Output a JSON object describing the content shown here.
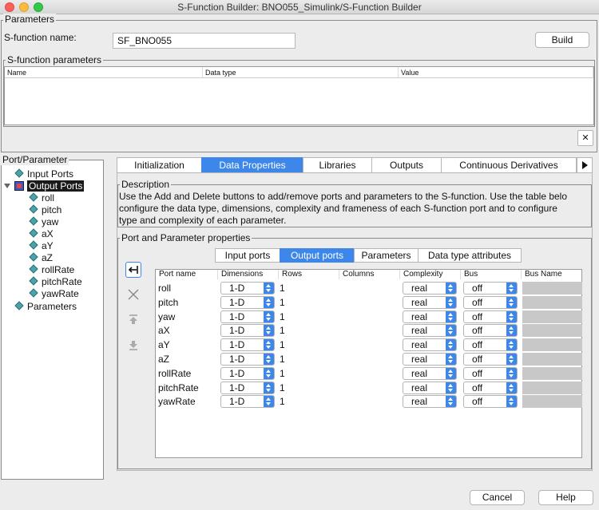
{
  "window": {
    "title": "S-Function Builder: BNO055_Simulink/S-Function Builder"
  },
  "parameters_group": {
    "title": "Parameters",
    "sfunction_name_label": "S-function name:",
    "sfunction_name_value": "SF_BNO055",
    "build_label": "Build"
  },
  "sfunction_params": {
    "title": "S-function parameters",
    "columns": [
      "Name",
      "Data type",
      "Value"
    ],
    "delete_label": "✕"
  },
  "tree": {
    "title": "Port/Parameter",
    "input_ports": "Input Ports",
    "output_ports": "Output Ports",
    "outputs": [
      "roll",
      "pitch",
      "yaw",
      "aX",
      "aY",
      "aZ",
      "rollRate",
      "pitchRate",
      "yawRate"
    ],
    "parameters": "Parameters"
  },
  "tabs": [
    "Initialization",
    "Data Properties",
    "Libraries",
    "Outputs",
    "Continuous Derivatives"
  ],
  "active_tab": "Data Properties",
  "description": {
    "title": "Description",
    "lines": [
      "Use the Add and Delete buttons to add/remove ports and parameters to the S-function. Use the table belo",
      "configure the data type, dimensions, complexity and frameness of each S-function port and to configure",
      "type and complexity of each parameter."
    ]
  },
  "port_props": {
    "title": "Port and Parameter properties",
    "subtabs": [
      "Input ports",
      "Output ports",
      "Parameters",
      "Data type attributes"
    ],
    "active_subtab": "Output ports",
    "columns": [
      "Port name",
      "Dimensions",
      "Rows",
      "Columns",
      "Complexity",
      "Bus",
      "Bus Name"
    ],
    "rows": [
      {
        "name": "roll",
        "dims": "1-D",
        "rows": "1",
        "complexity": "real",
        "bus": "off"
      },
      {
        "name": "pitch",
        "dims": "1-D",
        "rows": "1",
        "complexity": "real",
        "bus": "off"
      },
      {
        "name": "yaw",
        "dims": "1-D",
        "rows": "1",
        "complexity": "real",
        "bus": "off"
      },
      {
        "name": "aX",
        "dims": "1-D",
        "rows": "1",
        "complexity": "real",
        "bus": "off"
      },
      {
        "name": "aY",
        "dims": "1-D",
        "rows": "1",
        "complexity": "real",
        "bus": "off"
      },
      {
        "name": "aZ",
        "dims": "1-D",
        "rows": "1",
        "complexity": "real",
        "bus": "off"
      },
      {
        "name": "rollRate",
        "dims": "1-D",
        "rows": "1",
        "complexity": "real",
        "bus": "off"
      },
      {
        "name": "pitchRate",
        "dims": "1-D",
        "rows": "1",
        "complexity": "real",
        "bus": "off"
      },
      {
        "name": "yawRate",
        "dims": "1-D",
        "rows": "1",
        "complexity": "real",
        "bus": "off"
      }
    ]
  },
  "footer": {
    "cancel_label": "Cancel",
    "help_label": "Help"
  },
  "colors": {
    "accent": "#3d86ea",
    "window_bg": "#ececec"
  }
}
